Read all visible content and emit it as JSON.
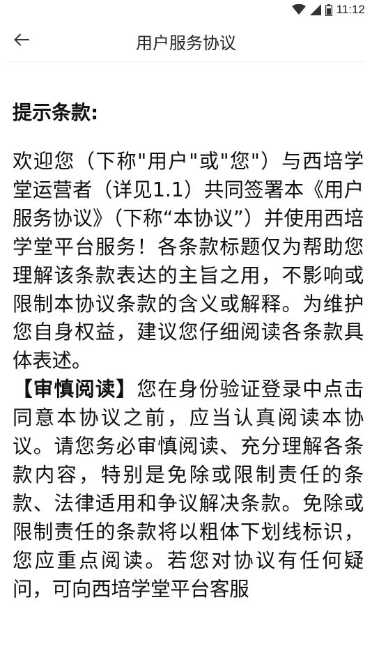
{
  "status_bar": {
    "time": "11:12",
    "icons": [
      "wifi-icon",
      "cellular-signal-icon",
      "battery-icon"
    ]
  },
  "app_bar": {
    "back_icon": "arrow-left-icon",
    "title": "用户服务协议"
  },
  "content": {
    "section_title": "提示条款:",
    "paragraph_1": "欢迎您（下称\"用户\"或\"您\"）与西培学堂运营者（详见1.1）共同签署本《用户服务协议》（下称“本协议”）并使用西培学堂平台服务！各条款标题仅为帮助您理解该条款表达的主旨之用，不影响或限制本协议条款的含义或解释。为维护您自身权益，建议您仔细阅读各条款具体表述。",
    "paragraph_2_bold": "【审慎阅读】",
    "paragraph_2_text": "您在身份验证登录中点击同意本协议之前，应当认真阅读本协议。请您务必审慎阅读、充分理解各条款内容，特别是免除或限制责任的条款、法律适用和争议解决条款。免除或限制责任的条款将以粗体下划线标识，您应重点阅读。若您对协议有任何疑问，可向西培学堂平台客服"
  }
}
